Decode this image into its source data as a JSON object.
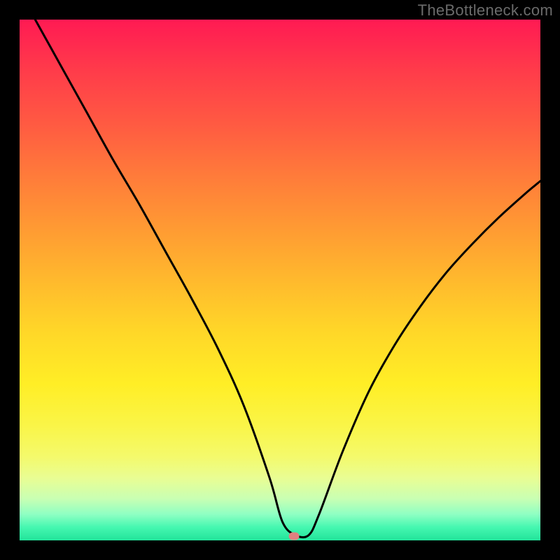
{
  "watermark": "TheBottleneck.com",
  "marker": {
    "x_frac": 0.527,
    "y_frac": 0.992
  },
  "chart_data": {
    "type": "line",
    "title": "",
    "xlabel": "",
    "ylabel": "",
    "xlim": [
      0,
      1
    ],
    "ylim": [
      0,
      1
    ],
    "series": [
      {
        "name": "curve",
        "x": [
          0.03,
          0.08,
          0.13,
          0.18,
          0.23,
          0.28,
          0.33,
          0.38,
          0.43,
          0.48,
          0.505,
          0.53,
          0.555,
          0.575,
          0.62,
          0.67,
          0.72,
          0.77,
          0.82,
          0.87,
          0.92,
          0.97,
          1.0
        ],
        "y": [
          1.0,
          0.91,
          0.82,
          0.73,
          0.645,
          0.555,
          0.465,
          0.37,
          0.26,
          0.12,
          0.035,
          0.01,
          0.01,
          0.05,
          0.17,
          0.285,
          0.375,
          0.45,
          0.515,
          0.57,
          0.62,
          0.665,
          0.69
        ]
      }
    ],
    "annotations": {
      "marker_point": {
        "x": 0.527,
        "y": 0.008
      }
    }
  }
}
